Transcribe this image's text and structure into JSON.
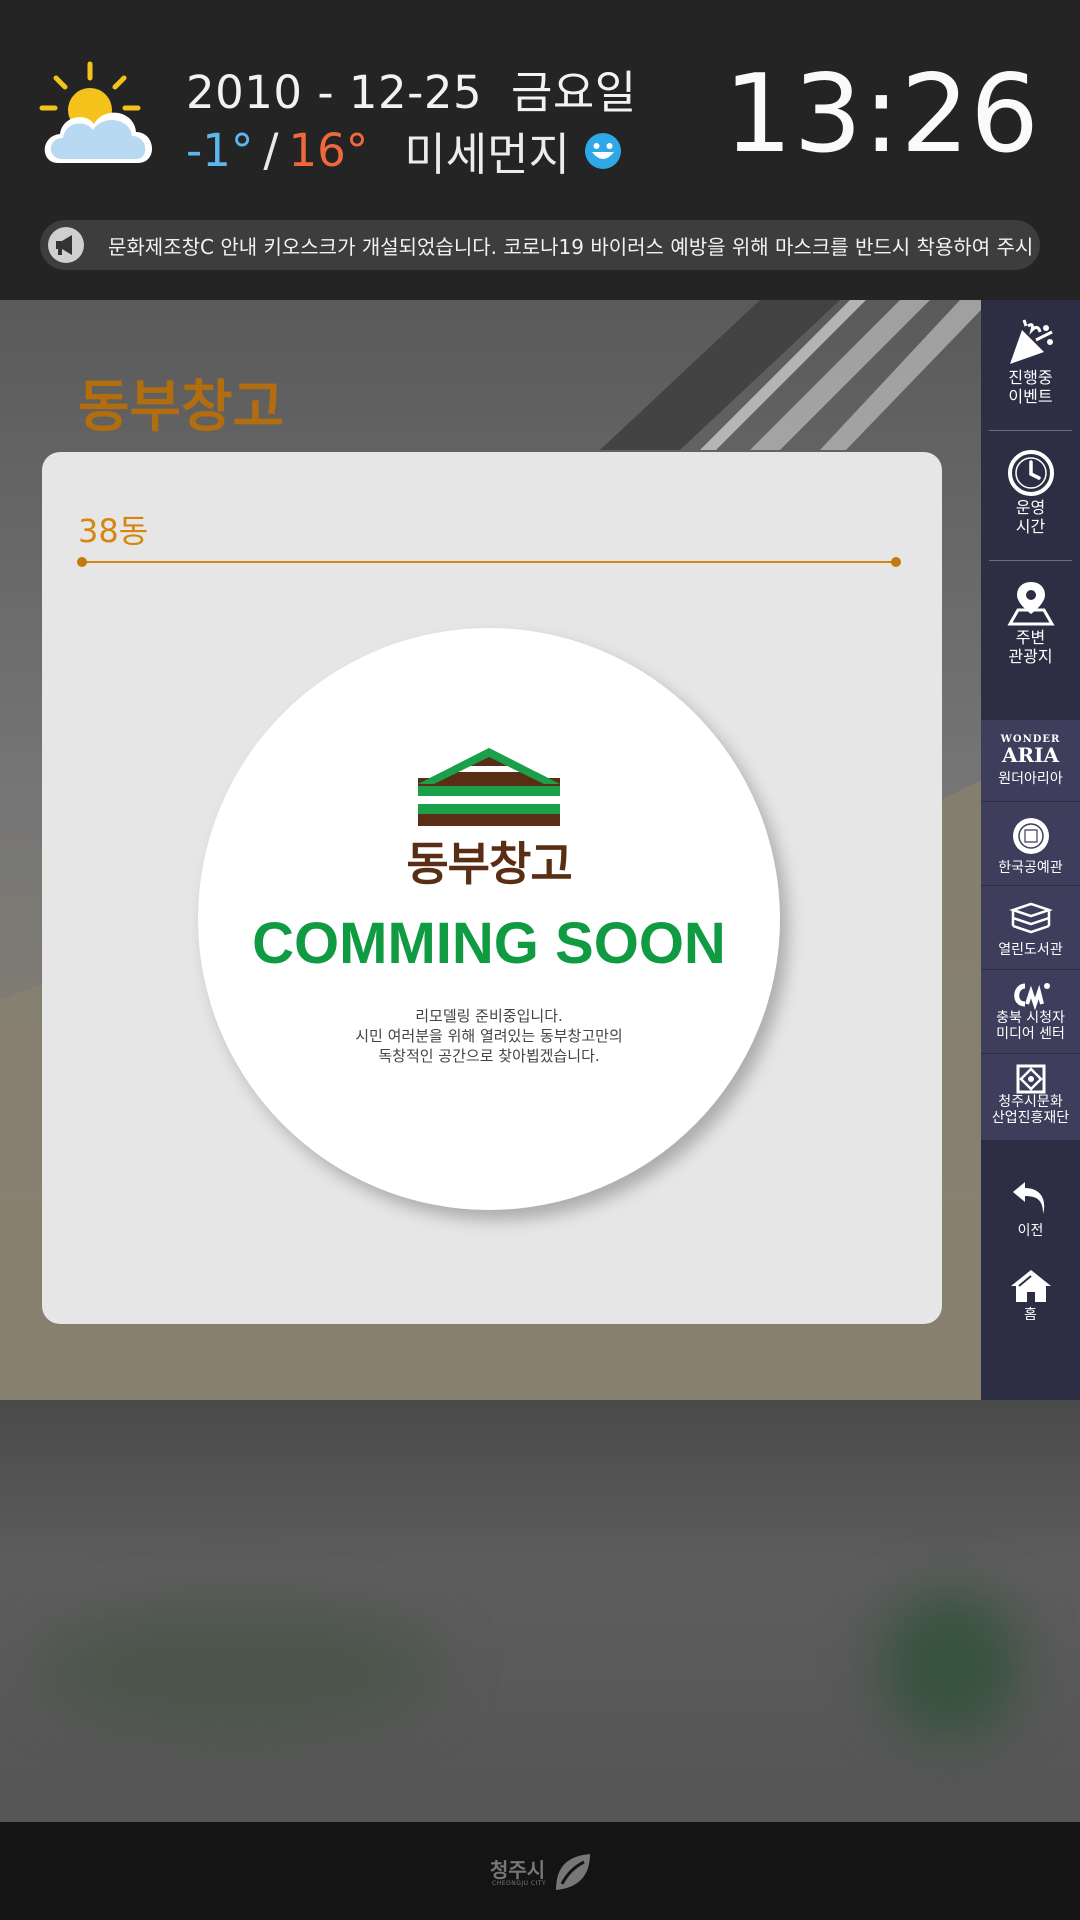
{
  "header": {
    "date": "2010 - 12-25",
    "weekday": "금요일",
    "temp_low": "-1°",
    "temp_separator": "/",
    "temp_high": "16°",
    "dust_label": "미세먼지",
    "dust_status_icon": "smiley-good-icon",
    "weather_icon": "partly-cloudy-icon",
    "clock": "13:26",
    "colors": {
      "temp_low": "#5cb7ec",
      "temp_high": "#f0693e"
    }
  },
  "notice": {
    "icon": "megaphone-icon",
    "text": "문화제조창C 안내 키오스크가 개설되었습니다. 코로나19 바이러스 예방을 위해 마스크를 반드시 착용하여 주시"
  },
  "main": {
    "title": "동부창고",
    "subtitle": "38동",
    "logo_text": "동부창고",
    "coming_soon": "COMMING SOON",
    "desc_line1": "리모델링 준비중입니다.",
    "desc_line2": "시민 여러분을 위해 열려있는 동부창고만의",
    "desc_line3": "독창적인 공간으로 찾아뵙겠습니다.",
    "colors": {
      "title": "#b26d0e",
      "accent": "#d6860f",
      "soon": "#109a42",
      "logo": "#5a2e14"
    }
  },
  "sidebar": {
    "items": [
      {
        "label1": "진행중",
        "label2": "이벤트",
        "icon": "party-popper-icon"
      },
      {
        "label1": "운영",
        "label2": "시간",
        "icon": "clock-icon"
      },
      {
        "label1": "주변",
        "label2": "관광지",
        "icon": "map-pin-icon"
      }
    ],
    "links": [
      {
        "logo_top": "WONDER",
        "logo_main": "ARIA",
        "label1": "원더아리아",
        "label2": ""
      },
      {
        "logo_top": "",
        "logo_main": "",
        "label1": "한국공예관",
        "label2": ""
      },
      {
        "logo_top": "",
        "logo_main": "",
        "label1": "열린도서관",
        "label2": ""
      },
      {
        "logo_top": "",
        "logo_main": "",
        "label1": "충북 시청자",
        "label2": "미디어 센터"
      },
      {
        "logo_top": "",
        "logo_main": "",
        "label1": "청주시문화",
        "label2": "산업진흥재단"
      }
    ],
    "back_label": "이전",
    "home_label": "홈"
  },
  "footer": {
    "logo_kr": "청주시",
    "logo_en": "CHEONGJU CITY"
  }
}
